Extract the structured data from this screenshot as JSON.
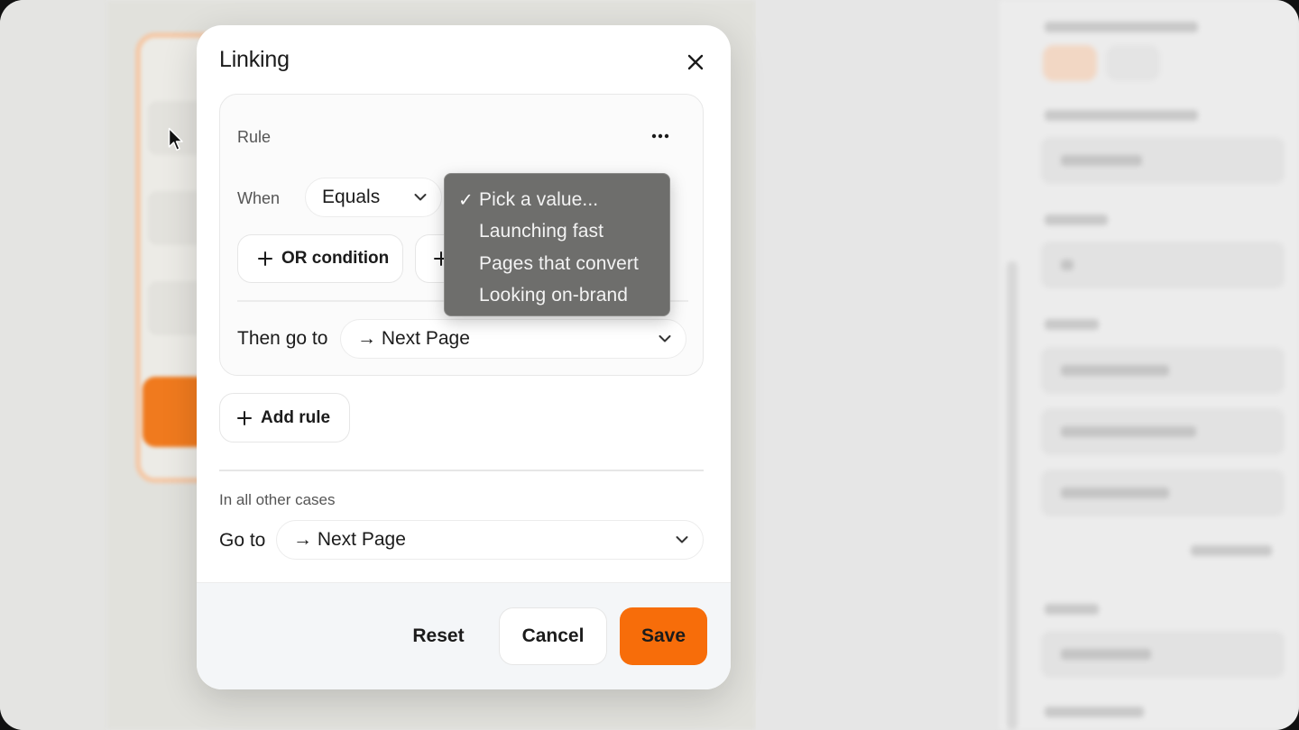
{
  "modal": {
    "title": "Linking",
    "rule": {
      "label": "Rule",
      "when_label": "When",
      "operator": "Equals",
      "or_condition_label": "OR condition",
      "and_condition_plus": "+",
      "then_label": "Then go to",
      "then_destination": "→ Next Page"
    },
    "value_dropdown": {
      "selected_index": 0,
      "options": [
        {
          "label": "Pick a value...",
          "checked": true
        },
        {
          "label": "Launching fast",
          "checked": false
        },
        {
          "label": "Pages that convert",
          "checked": false
        },
        {
          "label": "Looking on-brand",
          "checked": false
        }
      ],
      "check_glyph": "✓"
    },
    "add_rule_label": "Add rule",
    "other_cases_label": "In all other cases",
    "go_to_label": "Go to",
    "go_to_destination": "→ Next Page",
    "footer": {
      "reset_label": "Reset",
      "cancel_label": "Cancel",
      "save_label": "Save"
    }
  },
  "colors": {
    "accent": "#f76d0a",
    "dropdown_bg": "#6e6e6c",
    "background_card_border": "#f4c9a8"
  },
  "icons": [
    "close-icon",
    "more-icon",
    "chevron-down-icon",
    "plus-icon",
    "check-icon",
    "cursor-icon"
  ]
}
